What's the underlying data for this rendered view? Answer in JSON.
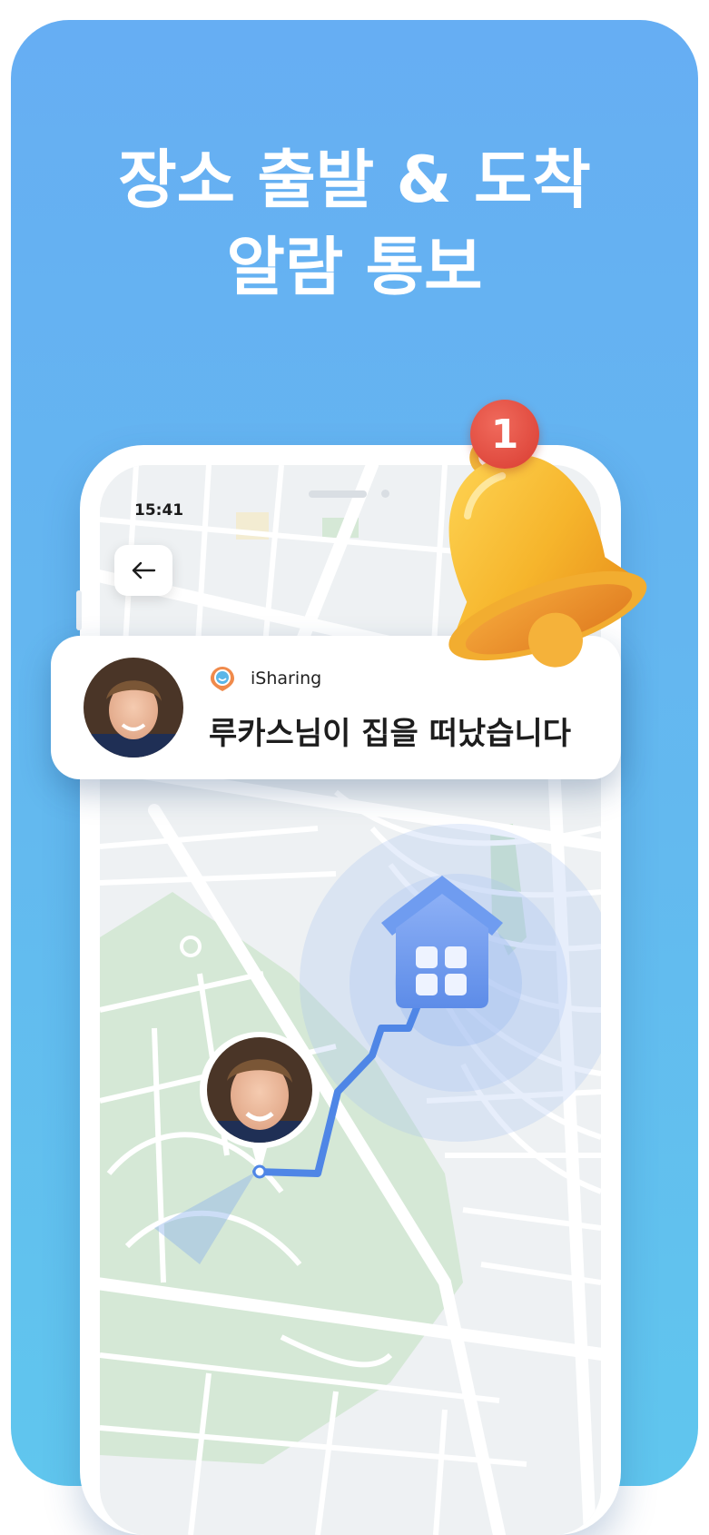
{
  "headline": {
    "line1": "장소 출발 & 도착",
    "line2": "알람 통보"
  },
  "status_bar": {
    "time": "15:41"
  },
  "notification": {
    "app_name": "iSharing",
    "message": "루카스님이 집을 떠났습니다"
  },
  "badge": {
    "count": "1"
  },
  "colors": {
    "background_top": "#66aef3",
    "background_bottom": "#60c6ee",
    "route": "#4f86e6",
    "home_pin": "#6f9cf0",
    "bell": "#f6c43a",
    "badge": "#e0473b",
    "park": "#d5e8d6"
  },
  "icons": {
    "back": "arrow-left-icon",
    "bell": "bell-icon",
    "home": "home-icon",
    "app": "isharing-logo-icon"
  }
}
